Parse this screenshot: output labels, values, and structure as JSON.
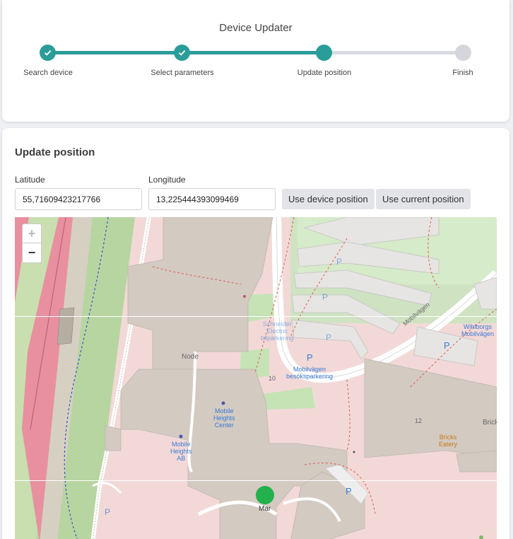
{
  "stepper": {
    "title": "Device Updater",
    "steps": [
      {
        "label": "Search device",
        "state": "done"
      },
      {
        "label": "Select parameters",
        "state": "done"
      },
      {
        "label": "Update position",
        "state": "current"
      },
      {
        "label": "Finish",
        "state": "todo"
      }
    ],
    "accent_color": "#2a9d99"
  },
  "update": {
    "title": "Update position",
    "latitude_label": "Latitude",
    "latitude_value": "55,71609423217766",
    "longitude_label": "Longitude",
    "longitude_value": "13,225444393099469",
    "use_device_position": "Use device position",
    "use_current_position": "Use current position"
  },
  "map": {
    "zoom_in": "+",
    "zoom_out": "−",
    "labels": {
      "node": "Node",
      "mobile_heights_center": "Mobile\nHeights\nCenter",
      "mobile_heights_ab": "Mobile\nHeights\nAB",
      "mobilvagen_street": "Mobilvägen",
      "mobilvagen_parking": "Mobilvägen\nbesöksparkering",
      "schneider_parking": "Schneider\nElectric\nbilparkering",
      "wihlborgs": "Wihlborgs\nMobilvägen",
      "bricks_eatery": "Bricks\nEatery",
      "brick_partial": "Brick",
      "marker_label": "Mar",
      "house_10": "10",
      "house_12": "12",
      "parking": "P"
    },
    "marker_color": "#22b14c"
  }
}
